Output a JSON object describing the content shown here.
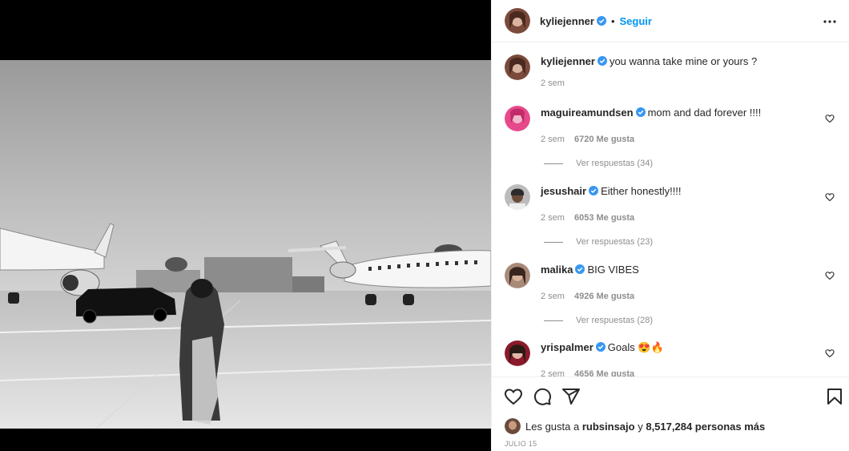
{
  "post": {
    "author": "kyliejenner",
    "follow_label": "Seguir",
    "dot": "•",
    "caption": "you wanna take mine or yours ?",
    "caption_time": "2 sem"
  },
  "comments": [
    {
      "user": "maguireamundsen",
      "text": "mom and dad forever !!!!",
      "time": "2 sem",
      "likes": "6720 Me gusta",
      "replies": "Ver respuestas (34)"
    },
    {
      "user": "jesushair",
      "text": "Either honestly!!!!",
      "time": "2 sem",
      "likes": "6053 Me gusta",
      "replies": "Ver respuestas (23)"
    },
    {
      "user": "malika",
      "text": "BIG VIBES",
      "time": "2 sem",
      "likes": "4926 Me gusta",
      "replies": "Ver respuestas (28)"
    },
    {
      "user": "yrispalmer",
      "text": "Goals 😍🔥",
      "time": "2 sem",
      "likes": "4656 Me gusta"
    }
  ],
  "likes_summary": {
    "prefix": "Les gusta a",
    "user": "rubsinsajo",
    "connector": "y",
    "count": "8,517,284 personas más"
  },
  "date": "JULIO 15",
  "colors": {
    "accent": "#0095f6",
    "verified": "#3897f0",
    "text": "#262626",
    "muted": "#8e8e8e"
  },
  "icons": [
    "more-icon",
    "verified-icon",
    "heart-icon",
    "comment-icon",
    "share-icon",
    "bookmark-icon"
  ]
}
